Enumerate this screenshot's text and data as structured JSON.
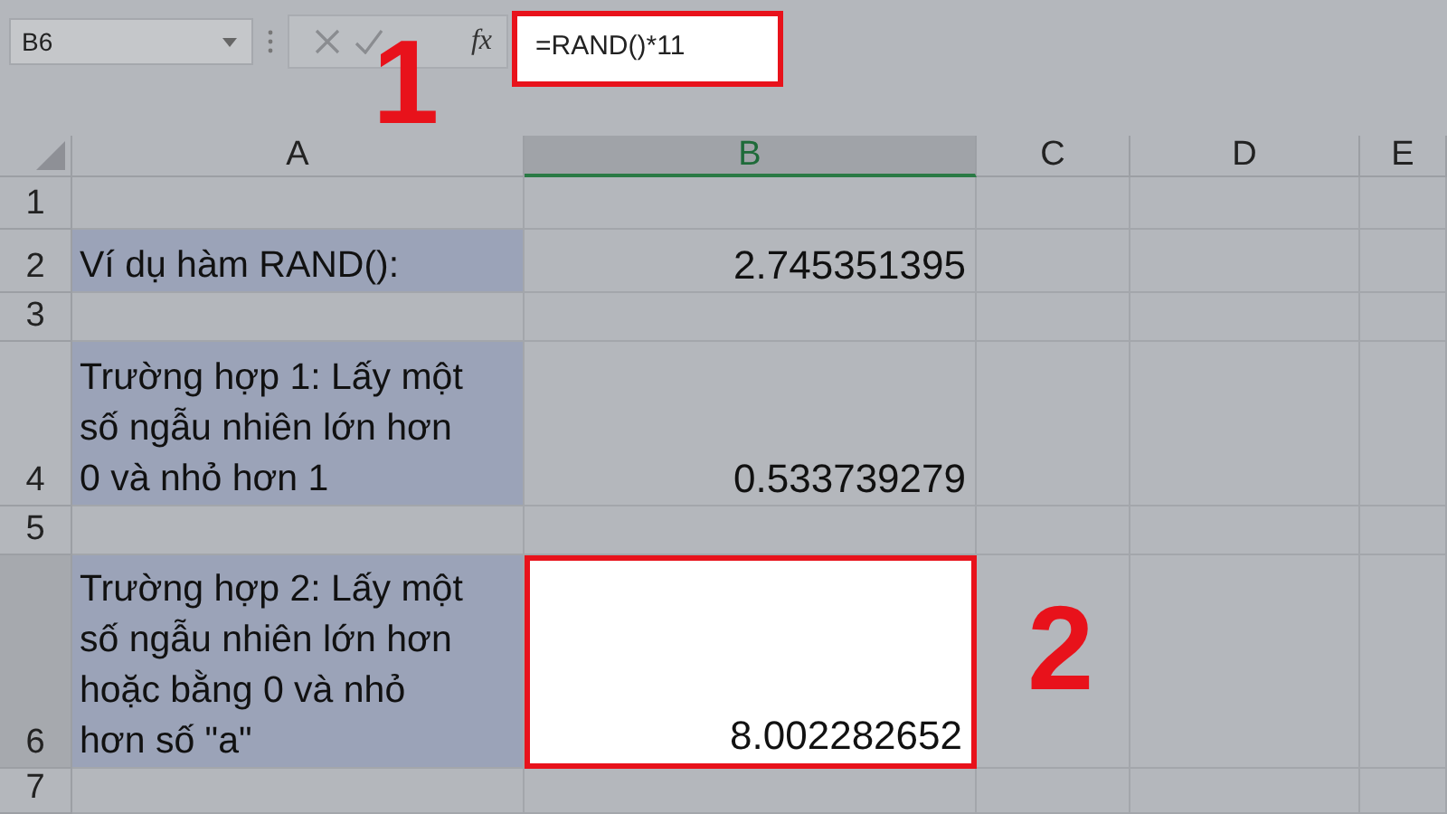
{
  "name_box": {
    "value": "B6"
  },
  "formula_bar": {
    "fx": "fx",
    "formula": "=RAND()*11",
    "highlighted": true
  },
  "columns": [
    {
      "label": "A",
      "selected": false
    },
    {
      "label": "B",
      "selected": true
    },
    {
      "label": "C",
      "selected": false
    },
    {
      "label": "D",
      "selected": false
    },
    {
      "label": "E",
      "selected": false
    }
  ],
  "rows": [
    {
      "number": "1",
      "selected": false
    },
    {
      "number": "2",
      "selected": false,
      "a": {
        "text": "Ví dụ hàm RAND():",
        "shaded": true
      },
      "b": {
        "text": "2.745351395",
        "selected": false
      }
    },
    {
      "number": "3",
      "selected": false
    },
    {
      "number": "4",
      "selected": false,
      "a": {
        "text": "Trường hợp 1: Lấy một số ngẫu nhiên lớn hơn 0 và nhỏ hơn 1",
        "shaded": true
      },
      "b": {
        "text": "0.533739279",
        "selected": false
      }
    },
    {
      "number": "5",
      "selected": false
    },
    {
      "number": "6",
      "selected": true,
      "a": {
        "text": "Trường hợp 2: Lấy một số ngẫu nhiên lớn hơn hoặc bằng 0 và nhỏ hơn số \"a\"",
        "shaded": true
      },
      "b": {
        "text": "8.002282652",
        "selected": true
      }
    },
    {
      "number": "7",
      "selected": false
    }
  ],
  "annotations": [
    {
      "label": "1"
    },
    {
      "label": "2"
    }
  ]
}
